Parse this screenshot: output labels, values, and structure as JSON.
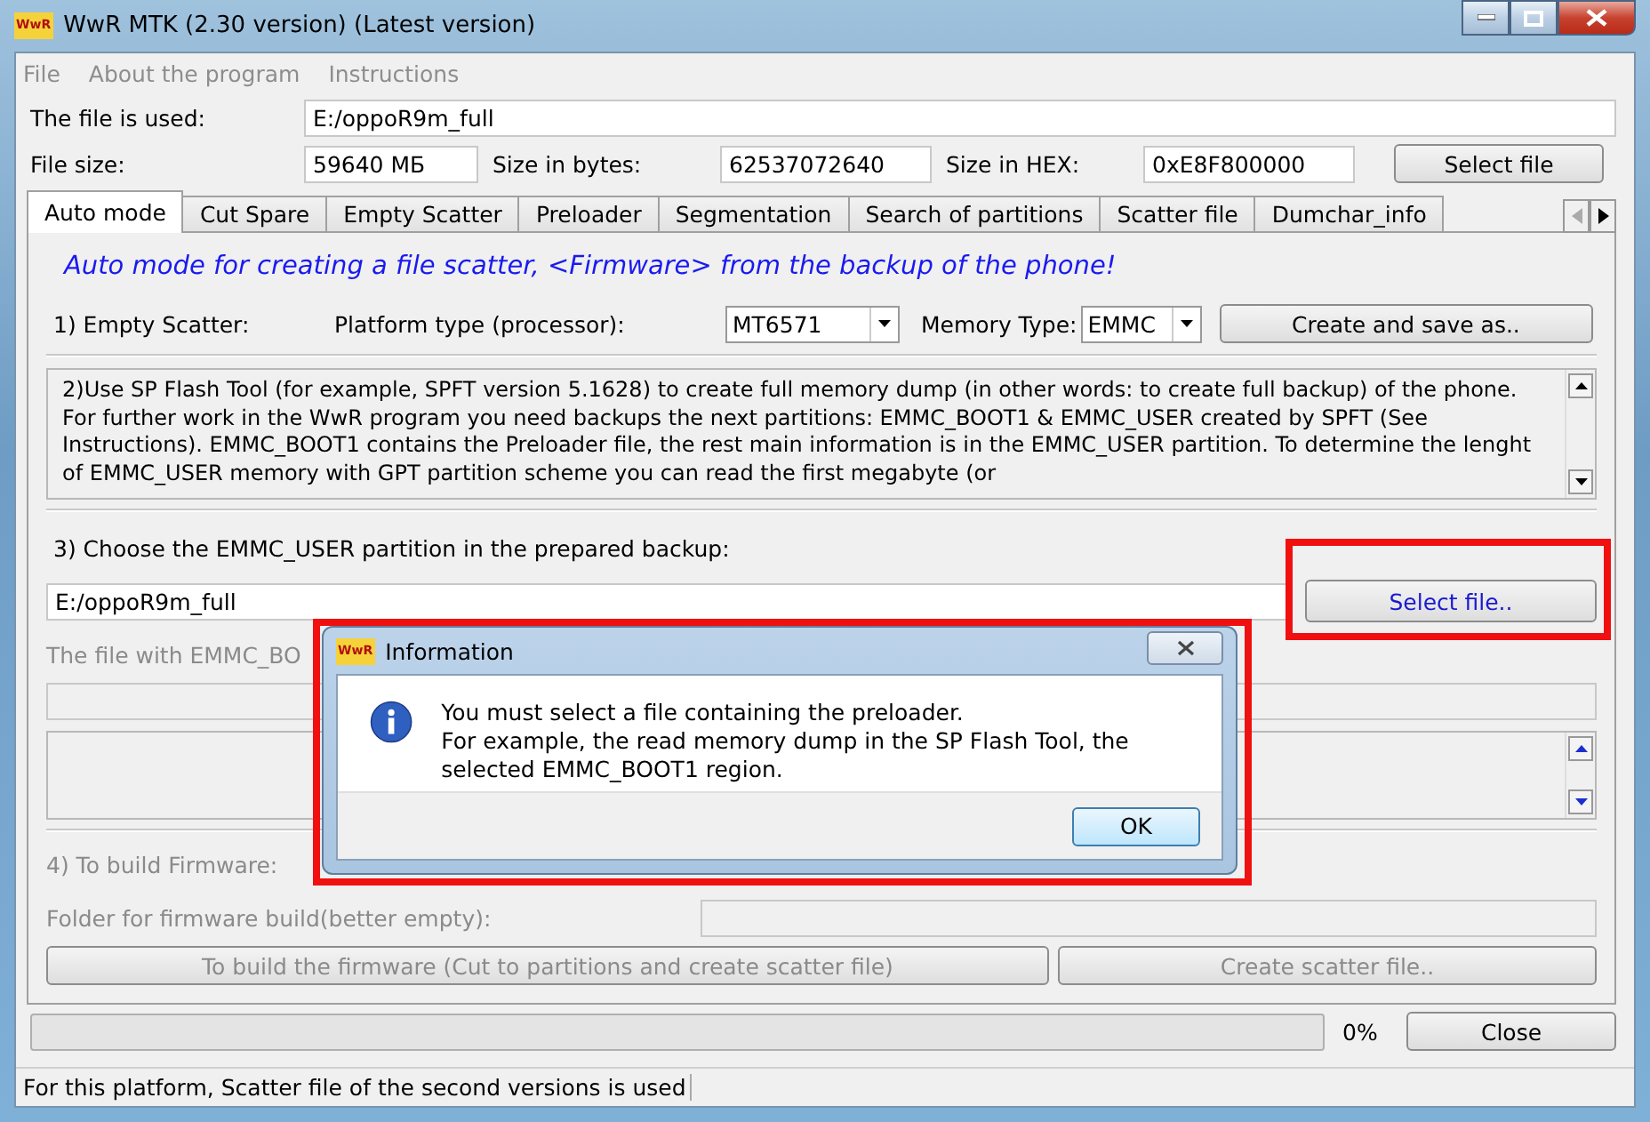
{
  "window": {
    "title": "WwR MTK (2.30 version) (Latest version)",
    "logo": "WwR"
  },
  "menu": [
    {
      "label": "File",
      "disabled": true
    },
    {
      "label": "About the program",
      "disabled": true
    },
    {
      "label": "Instructions",
      "disabled": true
    }
  ],
  "file_used": {
    "label": "The file is used:",
    "value": "E:/oppoR9m_full"
  },
  "sizes": [
    {
      "label": "File size:",
      "value": "59640 МБ"
    },
    {
      "label": "Size in bytes:",
      "value": "62537072640"
    },
    {
      "label": "Size in HEX:",
      "value": "0xE8F800000"
    }
  ],
  "select_file_button": "Select file",
  "tabs": [
    {
      "label": "Auto mode",
      "selected": true
    },
    {
      "label": "Cut Spare",
      "selected": false
    },
    {
      "label": "Empty Scatter",
      "selected": false
    },
    {
      "label": "Preloader",
      "selected": false
    },
    {
      "label": "Segmentation",
      "selected": false
    },
    {
      "label": "Search of partitions",
      "selected": false
    },
    {
      "label": "Scatter file",
      "selected": false
    },
    {
      "label": "Dumchar_info",
      "selected": false
    }
  ],
  "panel": {
    "heading": "Auto mode for creating a file scatter, <Firmware> from the backup of the phone!",
    "step1": {
      "label": "1) Empty Scatter:",
      "platform_label": "Platform type (processor):",
      "platform": "MT6571",
      "memory_label": "Memory Type:",
      "memory": "EMMC",
      "button": "Create and save as.."
    },
    "step2_text": "2)Use SP Flash Tool (for example, SPFT version 5.1628) to create full memory dump (in other words: to create full backup) of the phone. For further work in the WwR program you need backups the next partitions: EMMC_BOOT1 & EMMC_USER created by SPFT (See Instructions). EMMC_BOOT1 contains the Preloader file, the rest main information is in the EMMC_USER partition. To determine the lenght of EMMC_USER memory with GPT partition scheme you can read the first megabyte (or",
    "step3": {
      "label": "3) Choose the EMMC_USER partition in the prepared backup:",
      "value": "E:/oppoR9m_full",
      "button": "Select file..",
      "highlighted": true
    },
    "preloader_label": "The file with EMMC_BO",
    "step4": {
      "label": "4) To build Firmware:",
      "folder_label": "Folder for firmware build(better empty):",
      "build_button": "To build the firmware (Cut to partitions and create scatter file)",
      "scatter_button": "Create scatter file..",
      "disabled": true
    }
  },
  "progress": {
    "level": 0,
    "reading": "0%"
  },
  "close_button": "Close",
  "status_bar": "For this platform, Scatter file of the second versions is used",
  "dialog": {
    "title": "Information",
    "logo": "WwR",
    "message": [
      "You must select a file containing the preloader.",
      "For example, the read memory dump in the SP Flash Tool, the selected EMMC_BOOT1 region."
    ],
    "button": "OK",
    "highlighted": true
  }
}
